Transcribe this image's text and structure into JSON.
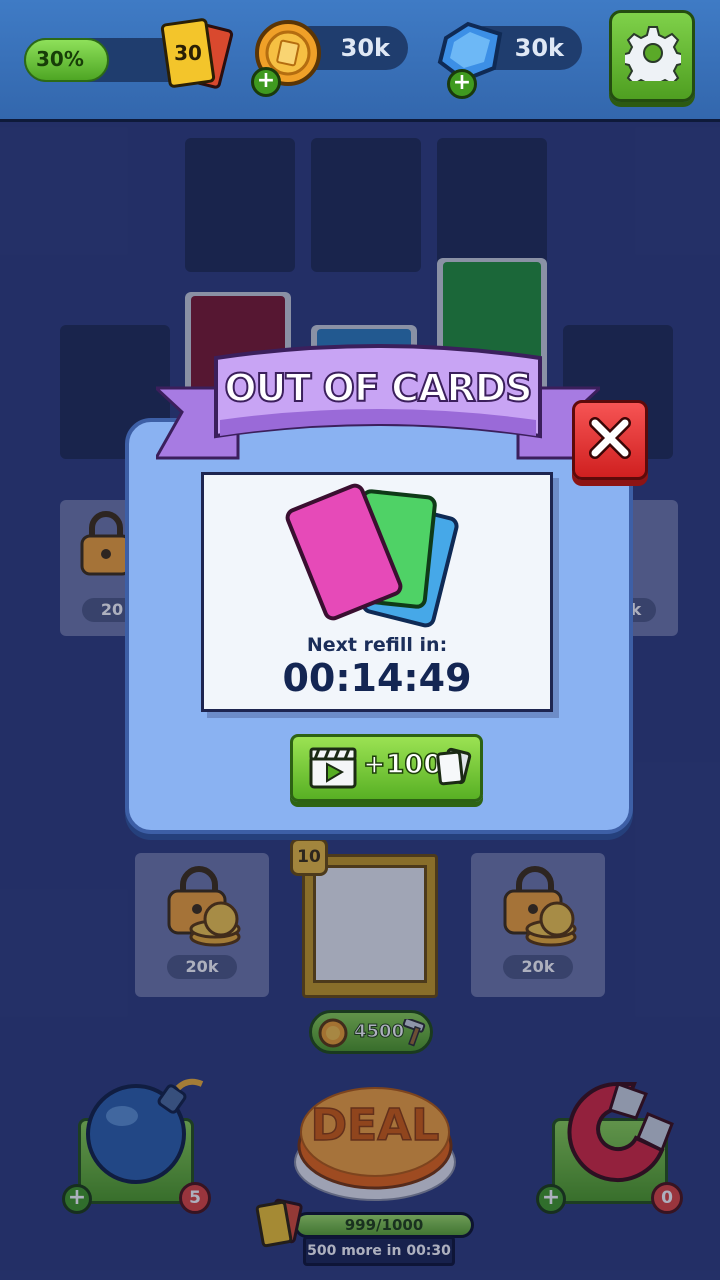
{
  "topbar": {
    "xp_percent_label": "30%",
    "xp_progress": 0.3,
    "level_card_label": "30",
    "coins_label": "30k",
    "gems_label": "30k"
  },
  "board": {
    "locked_prices": [
      "20k",
      "20k"
    ],
    "left_partial_price": "20",
    "right_partial_price": "k",
    "level_badge": "10",
    "deal_cost": "4500"
  },
  "modal": {
    "title": "OUT OF CARDS",
    "refill_label": "Next refill in:",
    "refill_timer": "00:14:49",
    "reward_label": "+100"
  },
  "bottom": {
    "deal_label": "DEAL",
    "energy_label": "999/1000",
    "energy_fraction": 0.999,
    "refill_info": "500 more in 00:30",
    "bomb_count": "5",
    "magnet_count": "0"
  },
  "colors": {
    "accent_green": "#58b024",
    "close_red": "#d02020",
    "ribbon_purple": "#b98ef0"
  }
}
